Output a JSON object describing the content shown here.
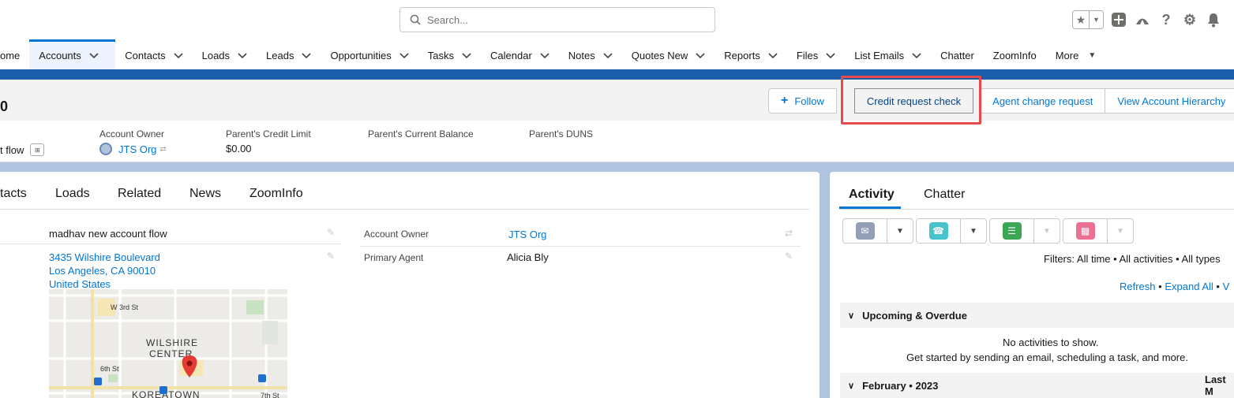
{
  "header": {
    "search_placeholder": "Search...",
    "icons": [
      "star-icon",
      "chevron-down-icon",
      "plus-icon",
      "trailhead-icon",
      "help-icon",
      "gear-icon",
      "bell-icon"
    ]
  },
  "nav": {
    "items": [
      {
        "label": "ome",
        "has_menu": false
      },
      {
        "label": "Accounts",
        "has_menu": true,
        "active": true
      },
      {
        "label": "Contacts",
        "has_menu": true
      },
      {
        "label": "Loads",
        "has_menu": true
      },
      {
        "label": "Leads",
        "has_menu": true
      },
      {
        "label": "Opportunities",
        "has_menu": true
      },
      {
        "label": "Tasks",
        "has_menu": true
      },
      {
        "label": "Calendar",
        "has_menu": true
      },
      {
        "label": "Notes",
        "has_menu": true
      },
      {
        "label": "Quotes New",
        "has_menu": true
      },
      {
        "label": "Reports",
        "has_menu": true
      },
      {
        "label": "Files",
        "has_menu": true
      },
      {
        "label": "List Emails",
        "has_menu": true
      },
      {
        "label": "Chatter",
        "has_menu": false
      },
      {
        "label": "ZoomInfo",
        "has_menu": false
      }
    ],
    "more_label": "More"
  },
  "record": {
    "name_fragment": "0",
    "actions": {
      "follow": "Follow",
      "credit_request": "Credit request check",
      "agent_change": "Agent change request",
      "view_hierarchy": "View Account Hierarchy"
    },
    "highlights": {
      "name_value_fragment": "t flow",
      "owner_label": "Account Owner",
      "owner_value": "JTS Org",
      "credit_limit_label": "Parent's Credit Limit",
      "credit_limit_value": "$0.00",
      "current_balance_label": "Parent's Current Balance",
      "duns_label": "Parent's DUNS"
    }
  },
  "detail": {
    "tabs": [
      "tacts",
      "Loads",
      "Related",
      "News",
      "ZoomInfo"
    ],
    "account_name_value": "madhav new account flow",
    "address_line1": "3435 Wilshire Boulevard",
    "address_line2": "Los Angeles, CA 90010",
    "address_line3": "United States",
    "owner_label": "Account Owner",
    "owner_value": "JTS Org",
    "primary_agent_label": "Primary Agent",
    "primary_agent_value": "Alicia Bly",
    "map_labels": {
      "street1": "W 3rd St",
      "district": "WILSHIRE",
      "district2": "CENTER",
      "street2": "6th St",
      "area": "KOREATOWN",
      "street3": "7th St",
      "metro": "M"
    }
  },
  "activity": {
    "tabs": [
      "Activity",
      "Chatter"
    ],
    "filters": "Filters: All time • All activities • All types",
    "refresh": "Refresh",
    "expand_all": "Expand All",
    "view_all_fragment": "V",
    "upcoming_header": "Upcoming & Overdue",
    "no_activities": "No activities to show.",
    "get_started": "Get started by sending an email, scheduling a task, and more.",
    "month_header": "February • 2023",
    "last_fragment": "Last M"
  },
  "colors": {
    "brand_band": "#1b5faa",
    "link": "#0176d3",
    "highlight_box": "#e8494a",
    "email_icon": "#939fb6",
    "call_icon": "#48c3cc",
    "task_icon": "#3ba755",
    "event_icon": "#eb7092"
  }
}
